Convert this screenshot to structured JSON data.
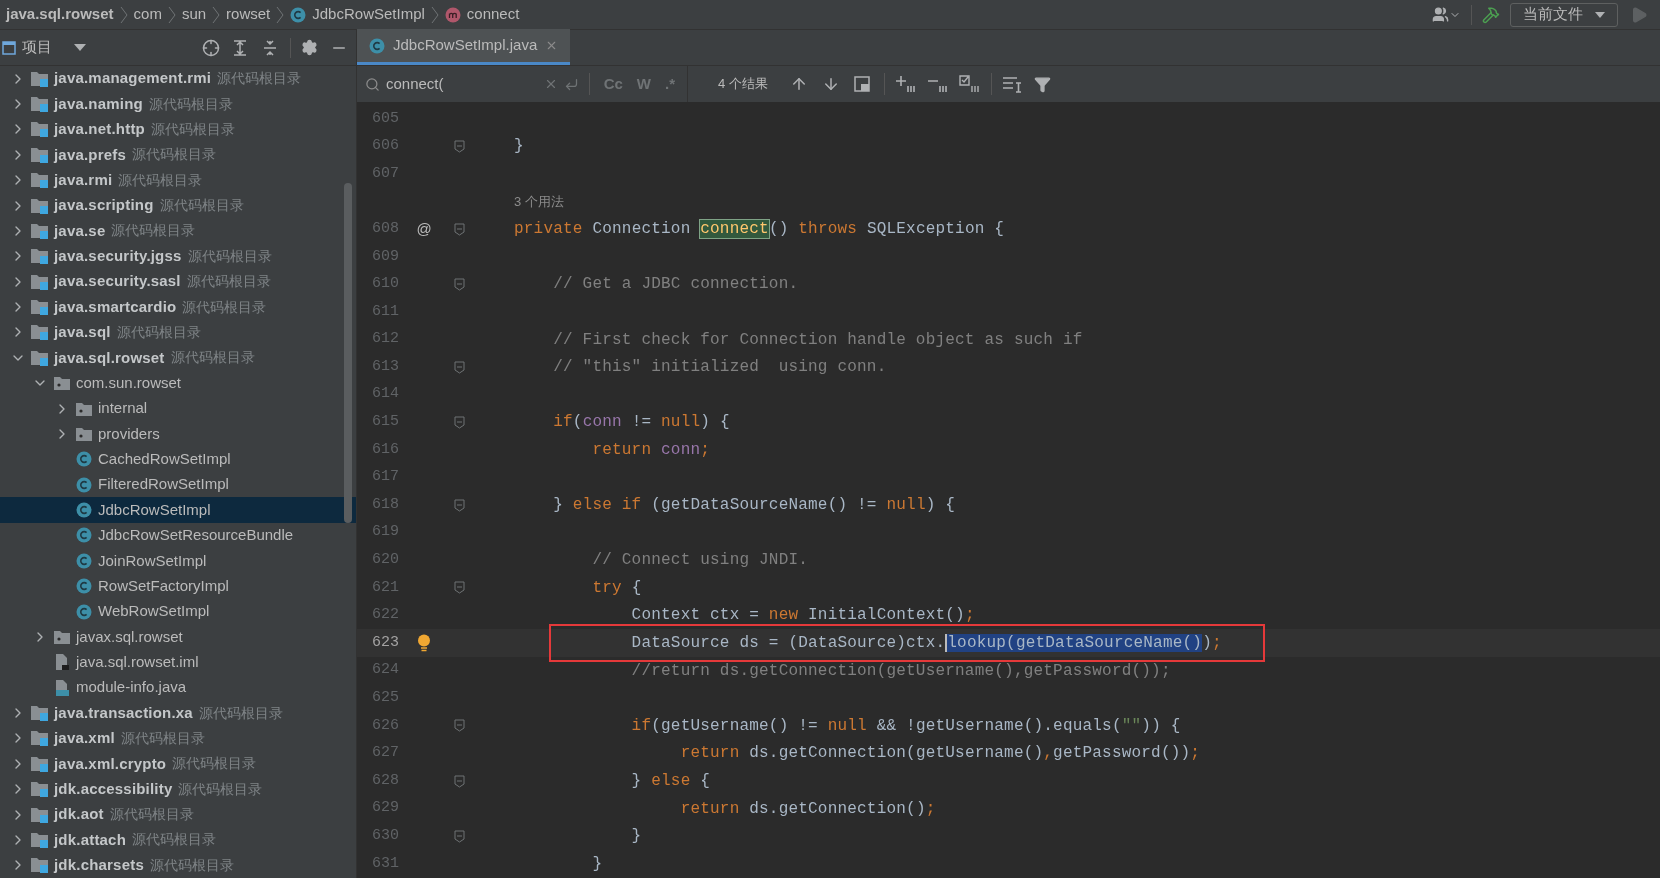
{
  "breadcrumbs": [
    {
      "label": "java.sql.rowset",
      "kind": "module"
    },
    {
      "label": "com",
      "kind": "package"
    },
    {
      "label": "sun",
      "kind": "package"
    },
    {
      "label": "rowset",
      "kind": "package"
    },
    {
      "label": "JdbcRowSetImpl",
      "kind": "class"
    },
    {
      "label": "connect",
      "kind": "method"
    }
  ],
  "toolbar": {
    "run_config": "当前文件",
    "run_enabled": false
  },
  "sidebar": {
    "title": "项目",
    "items": [
      {
        "label": "java.management.rmi",
        "hint": "源代码根目录",
        "kind": "module",
        "expanded": false,
        "selected": false
      },
      {
        "label": "java.naming",
        "hint": "源代码根目录",
        "kind": "module",
        "expanded": false,
        "selected": false
      },
      {
        "label": "java.net.http",
        "hint": "源代码根目录",
        "kind": "module",
        "expanded": false,
        "selected": false
      },
      {
        "label": "java.prefs",
        "hint": "源代码根目录",
        "kind": "module",
        "expanded": false,
        "selected": false
      },
      {
        "label": "java.rmi",
        "hint": "源代码根目录",
        "kind": "module",
        "expanded": false,
        "selected": false
      },
      {
        "label": "java.scripting",
        "hint": "源代码根目录",
        "kind": "module",
        "expanded": false,
        "selected": false
      },
      {
        "label": "java.se",
        "hint": "源代码根目录",
        "kind": "module",
        "expanded": false,
        "selected": false
      },
      {
        "label": "java.security.jgss",
        "hint": "源代码根目录",
        "kind": "module",
        "expanded": false,
        "selected": false
      },
      {
        "label": "java.security.sasl",
        "hint": "源代码根目录",
        "kind": "module",
        "expanded": false,
        "selected": false
      },
      {
        "label": "java.smartcardio",
        "hint": "源代码根目录",
        "kind": "module",
        "expanded": false,
        "selected": false
      },
      {
        "label": "java.sql",
        "hint": "源代码根目录",
        "kind": "module",
        "expanded": false,
        "selected": false
      },
      {
        "label": "java.sql.rowset",
        "hint": "源代码根目录",
        "kind": "module",
        "expanded": true,
        "selected": false,
        "children": [
          {
            "label": "com.sun.rowset",
            "kind": "package",
            "expanded": true,
            "selected": false,
            "children": [
              {
                "label": "internal",
                "kind": "package",
                "expanded": false,
                "selected": false
              },
              {
                "label": "providers",
                "kind": "package",
                "expanded": false,
                "selected": false
              },
              {
                "label": "CachedRowSetImpl",
                "kind": "class",
                "selected": false
              },
              {
                "label": "FilteredRowSetImpl",
                "kind": "class",
                "selected": false
              },
              {
                "label": "JdbcRowSetImpl",
                "kind": "class",
                "selected": true
              },
              {
                "label": "JdbcRowSetResourceBundle",
                "kind": "class",
                "selected": false
              },
              {
                "label": "JoinRowSetImpl",
                "kind": "class",
                "selected": false
              },
              {
                "label": "RowSetFactoryImpl",
                "kind": "class",
                "selected": false
              },
              {
                "label": "WebRowSetImpl",
                "kind": "class",
                "selected": false
              }
            ]
          },
          {
            "label": "javax.sql.rowset",
            "kind": "package",
            "expanded": false,
            "selected": false
          },
          {
            "label": "java.sql.rowset.iml",
            "kind": "file",
            "selected": false
          },
          {
            "label": "module-info.java",
            "kind": "java",
            "selected": false
          }
        ]
      },
      {
        "label": "java.transaction.xa",
        "hint": "源代码根目录",
        "kind": "module",
        "expanded": false,
        "selected": false
      },
      {
        "label": "java.xml",
        "hint": "源代码根目录",
        "kind": "module",
        "expanded": false,
        "selected": false
      },
      {
        "label": "java.xml.crypto",
        "hint": "源代码根目录",
        "kind": "module",
        "expanded": false,
        "selected": false
      },
      {
        "label": "jdk.accessibility",
        "hint": "源代码根目录",
        "kind": "module",
        "expanded": false,
        "selected": false
      },
      {
        "label": "jdk.aot",
        "hint": "源代码根目录",
        "kind": "module",
        "expanded": false,
        "selected": false
      },
      {
        "label": "jdk.attach",
        "hint": "源代码根目录",
        "kind": "module",
        "expanded": false,
        "selected": false
      },
      {
        "label": "jdk.charsets",
        "hint": "源代码根目录",
        "kind": "module",
        "expanded": false,
        "selected": false
      }
    ]
  },
  "tabs": [
    {
      "label": "JdbcRowSetImpl.java",
      "selected": true
    }
  ],
  "search": {
    "value": "connect(",
    "options": [
      {
        "label": "Cc",
        "selected": false
      },
      {
        "label": "W",
        "selected": false
      },
      {
        "label": ".*",
        "selected": false
      }
    ],
    "results": "4 个结果"
  },
  "lines": [
    {
      "kind": "code",
      "number": "605"
    },
    {
      "kind": "code",
      "number": "606",
      "fold": true,
      "segments": [
        {
          "kind": "plain",
          "t": "}"
        }
      ]
    },
    {
      "kind": "code",
      "number": "607"
    },
    {
      "kind": "hint",
      "text": "3 个用法"
    },
    {
      "kind": "code",
      "number": "608",
      "fold": true,
      "gutter_text": "@",
      "segments": [
        {
          "kind": "keyword",
          "t": "private "
        },
        {
          "kind": "plain",
          "t": "Connection "
        },
        {
          "kind": "match",
          "t": "connect"
        },
        {
          "kind": "plain",
          "t": "() "
        },
        {
          "kind": "keyword",
          "t": "throws "
        },
        {
          "kind": "plain",
          "t": "SQLException {"
        }
      ]
    },
    {
      "kind": "code",
      "number": "609"
    },
    {
      "kind": "code",
      "number": "610",
      "fold": true,
      "segments": [
        {
          "kind": "comment",
          "t": "    // Get a JDBC connection."
        }
      ]
    },
    {
      "kind": "code",
      "number": "611"
    },
    {
      "kind": "code",
      "number": "612",
      "segments": [
        {
          "kind": "comment",
          "t": "    // First check for Connection handle object as such if"
        }
      ]
    },
    {
      "kind": "code",
      "number": "613",
      "fold": true,
      "segments": [
        {
          "kind": "comment",
          "t": "    // \"this\" initialized  using conn."
        }
      ]
    },
    {
      "kind": "code",
      "number": "614"
    },
    {
      "kind": "code",
      "number": "615",
      "fold": true,
      "segments": [
        {
          "kind": "keyword",
          "t": "    if"
        },
        {
          "kind": "plain",
          "t": "("
        },
        {
          "kind": "field",
          "t": "conn"
        },
        {
          "kind": "plain",
          "t": " != "
        },
        {
          "kind": "keyword",
          "t": "null"
        },
        {
          "kind": "plain",
          "t": ") {"
        }
      ]
    },
    {
      "kind": "code",
      "number": "616",
      "segments": [
        {
          "kind": "keyword",
          "t": "        return "
        },
        {
          "kind": "field",
          "t": "conn"
        },
        {
          "kind": "keyword",
          "t": ";"
        }
      ]
    },
    {
      "kind": "code",
      "number": "617"
    },
    {
      "kind": "code",
      "number": "618",
      "fold": true,
      "segments": [
        {
          "kind": "plain",
          "t": "    } "
        },
        {
          "kind": "keyword",
          "t": "else if "
        },
        {
          "kind": "plain",
          "t": "(getDataSourceName() != "
        },
        {
          "kind": "keyword",
          "t": "null"
        },
        {
          "kind": "plain",
          "t": ") {"
        }
      ]
    },
    {
      "kind": "code",
      "number": "619"
    },
    {
      "kind": "code",
      "number": "620",
      "segments": [
        {
          "kind": "comment",
          "t": "        // Connect using JNDI."
        }
      ]
    },
    {
      "kind": "code",
      "number": "621",
      "fold": true,
      "segments": [
        {
          "kind": "keyword",
          "t": "        try "
        },
        {
          "kind": "plain",
          "t": "{"
        }
      ]
    },
    {
      "kind": "code",
      "number": "622",
      "segments": [
        {
          "kind": "plain",
          "t": "            Context ctx = "
        },
        {
          "kind": "keyword",
          "t": "new "
        },
        {
          "kind": "plain",
          "t": "InitialContext()"
        },
        {
          "kind": "keyword",
          "t": ";"
        }
      ]
    },
    {
      "kind": "code",
      "number": "623",
      "current": true,
      "boxed": true,
      "bulb": true,
      "segments": [
        {
          "kind": "plain",
          "t": "            DataSource ds = (DataSource)ctx."
        },
        {
          "kind": "selection",
          "t": "lookup(getDataSourceName()"
        },
        {
          "kind": "plain",
          "t": ")"
        },
        {
          "kind": "keyword",
          "t": ";"
        }
      ]
    },
    {
      "kind": "code",
      "number": "624",
      "segments": [
        {
          "kind": "comment",
          "t": "            //return ds.getConnection(getUsername(),getPassword());"
        }
      ]
    },
    {
      "kind": "code",
      "number": "625"
    },
    {
      "kind": "code",
      "number": "626",
      "fold": true,
      "segments": [
        {
          "kind": "keyword",
          "t": "            if"
        },
        {
          "kind": "plain",
          "t": "(getUsername() != "
        },
        {
          "kind": "keyword",
          "t": "null "
        },
        {
          "kind": "plain",
          "t": "&& !getUsername().equals("
        },
        {
          "kind": "string",
          "t": "\"\""
        },
        {
          "kind": "plain",
          "t": ")) {"
        }
      ]
    },
    {
      "kind": "code",
      "number": "627",
      "segments": [
        {
          "kind": "keyword",
          "t": "                 return "
        },
        {
          "kind": "plain",
          "t": "ds.getConnection(getUsername()"
        },
        {
          "kind": "keyword",
          "t": ","
        },
        {
          "kind": "plain",
          "t": "getPassword())"
        },
        {
          "kind": "keyword",
          "t": ";"
        }
      ]
    },
    {
      "kind": "code",
      "number": "628",
      "fold": true,
      "segments": [
        {
          "kind": "plain",
          "t": "            } "
        },
        {
          "kind": "keyword",
          "t": "else "
        },
        {
          "kind": "plain",
          "t": "{"
        }
      ]
    },
    {
      "kind": "code",
      "number": "629",
      "segments": [
        {
          "kind": "keyword",
          "t": "                 return "
        },
        {
          "kind": "plain",
          "t": "ds.getConnection()"
        },
        {
          "kind": "keyword",
          "t": ";"
        }
      ]
    },
    {
      "kind": "code",
      "number": "630",
      "fold": true,
      "segments": [
        {
          "kind": "plain",
          "t": "            }"
        }
      ]
    },
    {
      "kind": "code",
      "number": "631",
      "segments": [
        {
          "kind": "plain",
          "t": "        }"
        }
      ]
    }
  ]
}
